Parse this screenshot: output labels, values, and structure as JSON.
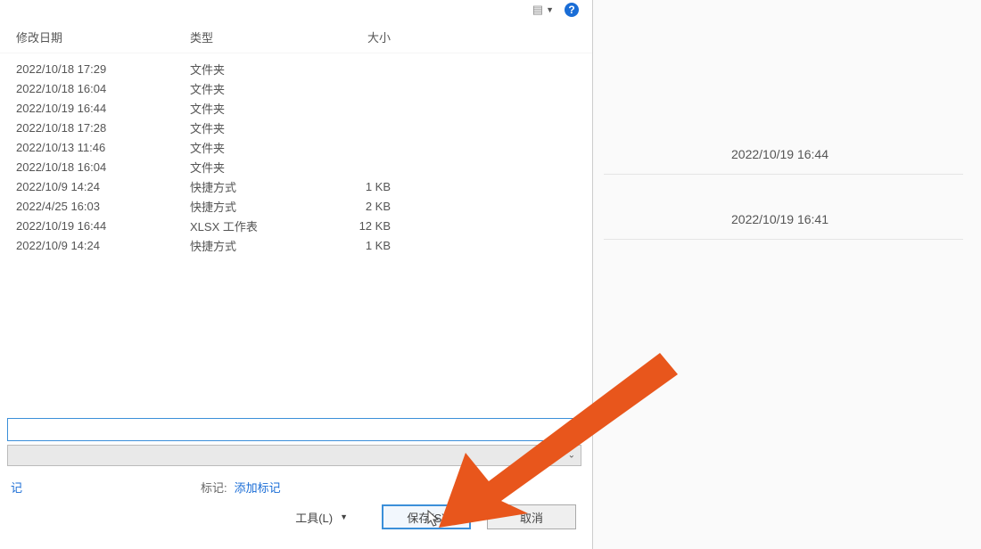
{
  "toolbar": {
    "view_label": "",
    "help_glyph": "?"
  },
  "columns": {
    "date": "修改日期",
    "type": "类型",
    "size": "大小"
  },
  "rows": [
    {
      "date": "2022/10/18 17:29",
      "type": "文件夹",
      "size": ""
    },
    {
      "date": "2022/10/18 16:04",
      "type": "文件夹",
      "size": ""
    },
    {
      "date": "2022/10/19 16:44",
      "type": "文件夹",
      "size": ""
    },
    {
      "date": "2022/10/18 17:28",
      "type": "文件夹",
      "size": ""
    },
    {
      "date": "2022/10/13 11:46",
      "type": "文件夹",
      "size": ""
    },
    {
      "date": "2022/10/18 16:04",
      "type": "文件夹",
      "size": ""
    },
    {
      "date": "2022/10/9 14:24",
      "type": "快捷方式",
      "size": "1 KB"
    },
    {
      "date": "2022/4/25 16:03",
      "type": "快捷方式",
      "size": "2 KB"
    },
    {
      "date": "2022/10/19 16:44",
      "type": "XLSX 工作表",
      "size": "12 KB"
    },
    {
      "date": "2022/10/9 14:24",
      "type": "快捷方式",
      "size": "1 KB"
    }
  ],
  "meta": {
    "author_fragment": "记",
    "tag_label": "标记:",
    "tag_link": "添加标记"
  },
  "buttons": {
    "tools": "工具(L)",
    "save": "保存(S)",
    "cancel": "取消"
  },
  "background": {
    "time1": "2022/10/19 16:44",
    "time2": "2022/10/19 16:41"
  },
  "icons": {
    "view": "view-icon",
    "help": "help-icon",
    "dropdown": "chevron-down-icon"
  }
}
